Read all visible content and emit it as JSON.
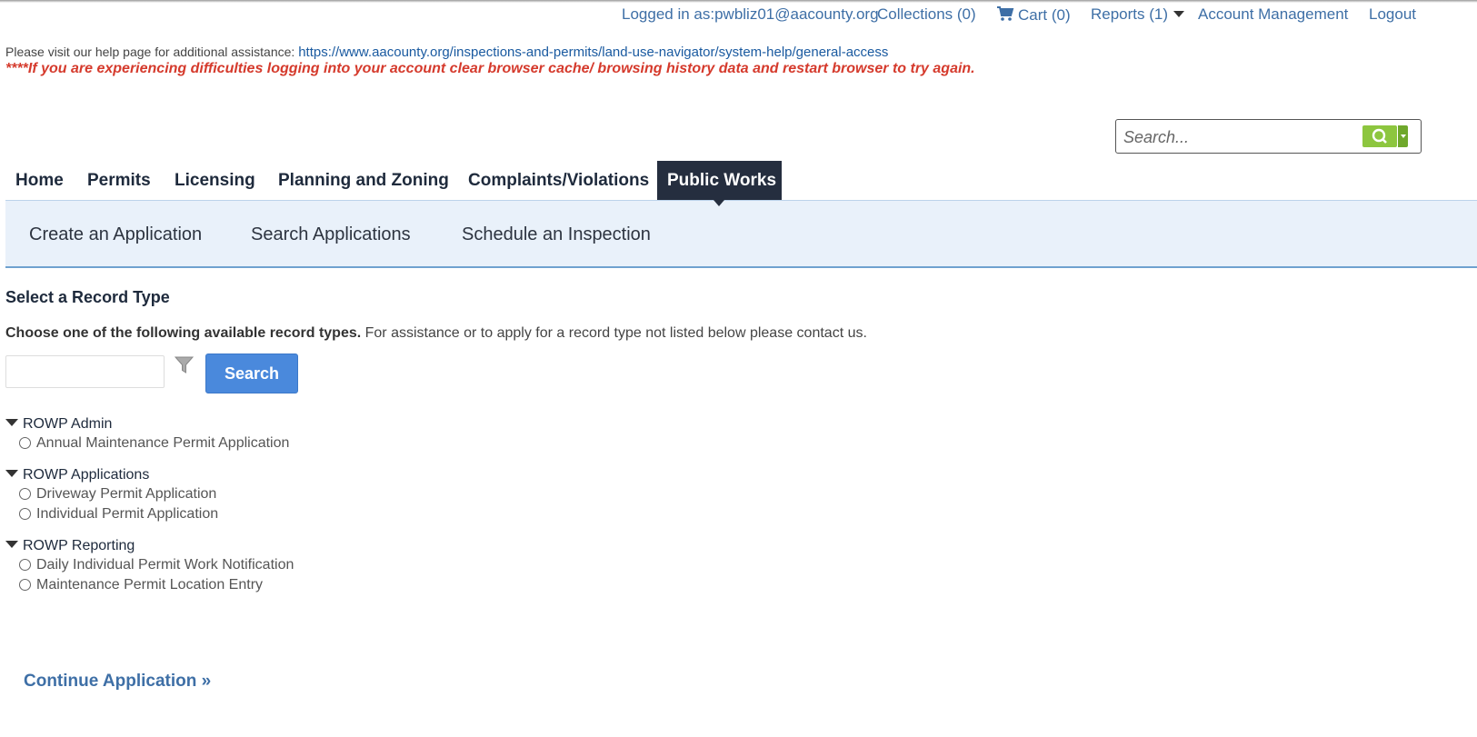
{
  "header": {
    "logged_in": "Logged in as:pwbliz01@aacounty.org",
    "collections": "Collections (0)",
    "cart": "Cart (0)",
    "reports": "Reports (1)",
    "account_management": "Account Management",
    "logout": "Logout"
  },
  "help": {
    "text": "Please visit our help page for additional assistance:",
    "link": "https://www.aacounty.org/inspections-and-permits/land-use-navigator/system-help/general-access",
    "warning": "****If you are experiencing difficulties logging into your account clear browser cache/ browsing history data and restart browser to try again."
  },
  "global_search": {
    "placeholder": "Search..."
  },
  "nav": {
    "tabs": [
      "Home",
      "Permits",
      "Licensing",
      "Planning and Zoning",
      "Complaints/Violations",
      "Public Works"
    ],
    "active": "Public Works"
  },
  "subnav": [
    "Create an Application",
    "Search Applications",
    "Schedule an Inspection"
  ],
  "record_select": {
    "title": "Select a Record Type",
    "instruction_bold": "Choose one of the following available record types.",
    "instruction_rest": " For assistance or to apply for a record type not listed below please contact us.",
    "search_button": "Search",
    "groups": [
      {
        "name": "ROWP Admin",
        "options": [
          "Annual Maintenance Permit Application"
        ]
      },
      {
        "name": "ROWP Applications",
        "options": [
          "Driveway Permit Application",
          "Individual Permit Application"
        ]
      },
      {
        "name": "ROWP Reporting",
        "options": [
          "Daily Individual Permit Work Notification",
          "Maintenance Permit Location Entry"
        ]
      }
    ]
  },
  "continue": "Continue Application »",
  "colors": {
    "accent": "#3e6fa6",
    "warning": "#d53a2c",
    "active_tab": "#252e3f",
    "search_button": "#4a89dc",
    "global_search_button": "#8dc63f"
  }
}
